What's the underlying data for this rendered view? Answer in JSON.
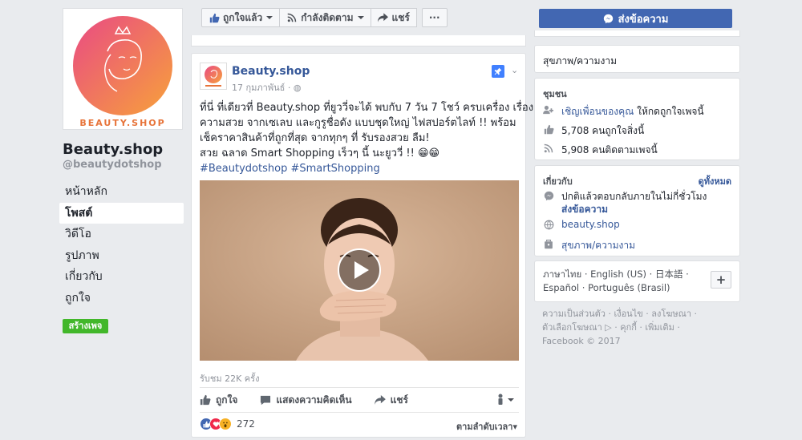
{
  "brand_colors": {
    "fb_blue": "#4267b2",
    "link": "#365899",
    "green": "#42b72a",
    "logo_gradient_start": "#e94a84",
    "logo_gradient_end": "#f7a23a"
  },
  "page": {
    "name": "Beauty.shop",
    "handle": "@beautydotshop",
    "logo_text": "BEAUTY.SHOP"
  },
  "left_nav": {
    "items": [
      {
        "label": "หน้าหลัก"
      },
      {
        "label": "โพสต์"
      },
      {
        "label": "วิดีโอ"
      },
      {
        "label": "รูปภาพ"
      },
      {
        "label": "เกี่ยวกับ"
      },
      {
        "label": "ถูกใจ"
      }
    ],
    "active_index": 1,
    "create_page_label": "สร้างเพจ"
  },
  "topbar": {
    "liked_label": "ถูกใจแล้ว",
    "following_label": "กำลังติดตาม",
    "share_label": "แชร์",
    "more_label": "···"
  },
  "post": {
    "author": "Beauty.shop",
    "date": "17 กุมภาพันธ์ · ",
    "text_lines": [
      "ที่นี่ ที่เดียวที่ Beauty.shop ที่ยูววี่จะได้ พบกับ 7 วัน 7 โชว์ ครบเครื่อง เรื่อง",
      "ความสวย จากเซเลบ และกูรูชื่อดัง แบบชุดใหญ่ ไฟสปอร์ตไลท์ !! พร้อม",
      "เช็คราคาสินค้าที่ถูกที่สุด จากทุกๆ ที่ รับรองสวย ลืม!",
      "สวย ฉลาด Smart Shopping เร็วๆ นี้ นะยูววี่ !! 😁😁"
    ],
    "hashtags": "#Beautydotshop #SmartShopping",
    "views": "รับชม 22K ครั้ง",
    "actions": {
      "like": "ถูกใจ",
      "comment": "แสดงความคิดเห็น",
      "share": "แชร์"
    },
    "reaction_count": "272",
    "sort_label": "ตามลำดับเวลา"
  },
  "right": {
    "send_message_label": "ส่งข้อความ",
    "category": "สุขภาพ/ความงาม",
    "community": {
      "title": "ชุมชน",
      "invite_link": "เชิญเพื่อนของคุณ",
      "invite_rest": " ให้กดถูกใจเพจนี้",
      "likes": "5,708 คนถูกใจสิ่งนี้",
      "follows": "5,908 คนติดตามเพจนี้"
    },
    "about": {
      "title": "เกี่ยวกับ",
      "see_all": "ดูทั้งหมด",
      "response": "ปกติแล้วตอบกลับภายในไม่กี่ชั่วโมง",
      "send_message_link": "ส่งข้อความ",
      "website": "beauty.shop",
      "category": "สุขภาพ/ความงาม"
    },
    "languages": {
      "line1": "ภาษาไทย · English (US) · 日本語 ·",
      "line2": "Español · Português (Brasil)",
      "add_label": "+"
    },
    "footer": {
      "line1": "ความเป็นส่วนตัว · เงื่อนไข · ลงโฆษณา ·",
      "line2": "ตัวเลือกโฆษณา ▷ · คุกกี้ · เพิ่มเติม ·",
      "line3": "Facebook © 2017"
    }
  }
}
